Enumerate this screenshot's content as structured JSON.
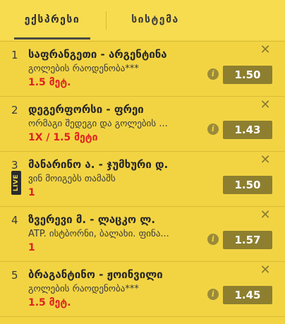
{
  "tabs": {
    "express": "ექსპრესი",
    "system": "სისტემა"
  },
  "bets": [
    {
      "num": "1",
      "title": "საფრანგეთი - არგენტინა",
      "market": "გოლების რაოდენობა***",
      "pick": "1.5 მეტ.",
      "odds": "1.50",
      "live": false
    },
    {
      "num": "2",
      "title": "დეგერფორსი - ფრეი",
      "market": "ორმაგი შედეგი და გოლების ...",
      "pick": "1X / 1.5 მეტი",
      "odds": "1.43",
      "live": false
    },
    {
      "num": "3",
      "title": "მანარინო ა. - ჯუმხური დ.",
      "market": "ვინ მოიგებს თამაშს",
      "pick": "1",
      "odds": "1.50",
      "live": true,
      "live_label": "LIVE"
    },
    {
      "num": "4",
      "title": "ზვერევი მ. - ლაცკო ლ.",
      "market": "ATP. ისტბორნი, ბალახი. ფინა...",
      "pick": "1",
      "odds": "1.57",
      "live": false
    },
    {
      "num": "5",
      "title": "ბრაგანტინო - ჟოინვილი",
      "market": "გოლების რაოდენობა***",
      "pick": "1.5 მეტ.",
      "odds": "1.45",
      "live": false
    }
  ],
  "icons": {
    "close": "✕",
    "info": "i"
  },
  "colors": {
    "background": "#f2d443",
    "odds_button": "#8d7f2f",
    "pick_text": "#e02020"
  }
}
